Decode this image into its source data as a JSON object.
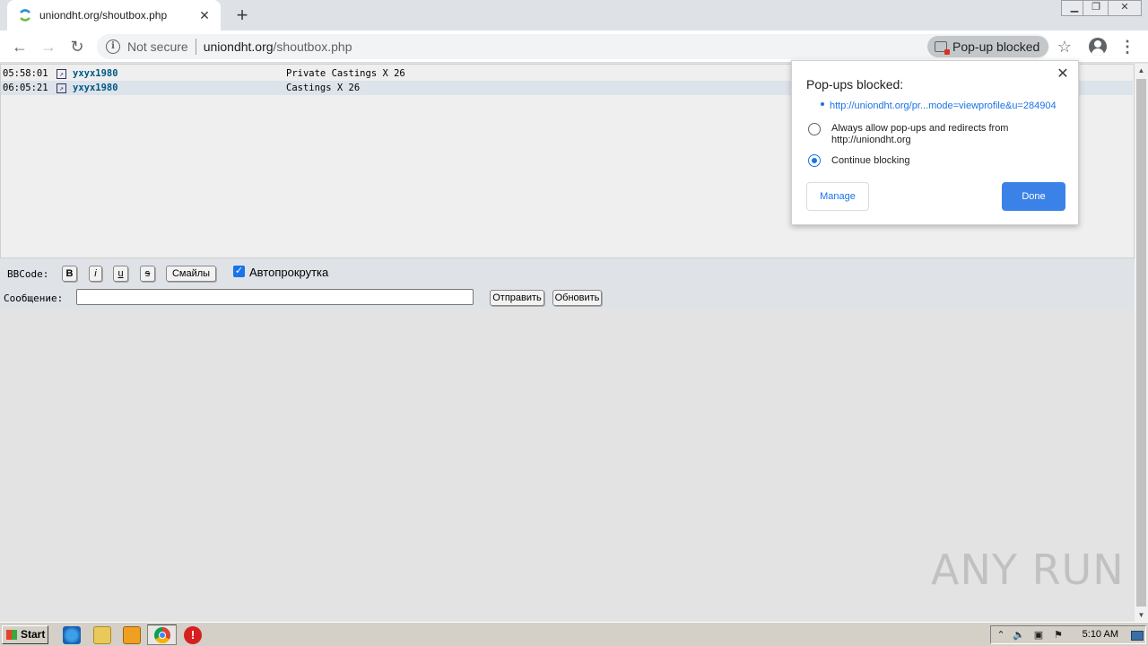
{
  "browser": {
    "tab_title": "uniondht.org/shoutbox.php",
    "omnibox": {
      "security_label": "Not secure",
      "url_host": "uniondht.org",
      "url_path": "/shoutbox.php"
    },
    "popup_chip": "Pop-up blocked"
  },
  "shouts": [
    {
      "time": "05:58:01",
      "user": "yxyx1980",
      "message": "Private Castings X 26"
    },
    {
      "time": "06:05:21",
      "user": "yxyx1980",
      "message": "Castings X 26"
    }
  ],
  "controls": {
    "bbcode_label": "BBCode:",
    "bold": "B",
    "italic": "i",
    "underline": "u",
    "strike": "s",
    "smileys": "Смайлы",
    "autoscroll_label": "Автопрокрутка",
    "message_label": "Сообщение:",
    "send": "Отправить",
    "refresh": "Обновить"
  },
  "popup_bubble": {
    "title": "Pop-ups blocked:",
    "link": "http://uniondht.org/pr...mode=viewprofile&u=284904",
    "option_allow": "Always allow pop-ups and redirects from http://uniondht.org",
    "option_block": "Continue blocking",
    "manage": "Manage",
    "done": "Done"
  },
  "watermark": "ANY RUN",
  "taskbar": {
    "start": "Start",
    "clock": "5:10 AM"
  },
  "colors": {
    "accent": "#1a73e8",
    "username": "#005784",
    "row_alt": "#dde3ea"
  }
}
